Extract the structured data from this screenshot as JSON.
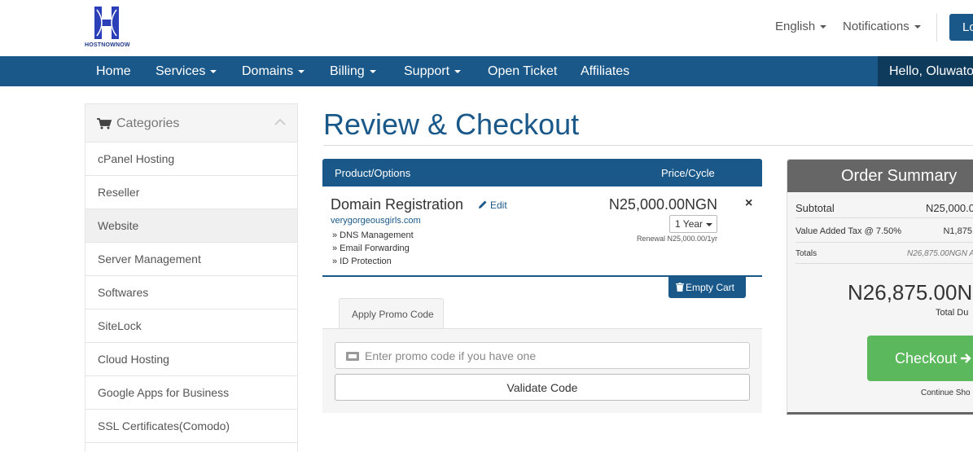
{
  "brand": {
    "logo_text": "HOSTNOWNOW"
  },
  "topbar": {
    "language": "English",
    "notifications": "Notifications",
    "login_label": "Lo"
  },
  "nav": {
    "items": [
      "Home",
      "Services",
      "Domains",
      "Billing",
      "Support",
      "Open Ticket",
      "Affiliates"
    ],
    "greeting": "Hello, Oluwato"
  },
  "sidebar": {
    "title": "Categories",
    "items": [
      "cPanel Hosting",
      "Reseller",
      "Website",
      "Server Management",
      "Softwares",
      "SiteLock",
      "Cloud Hosting",
      "Google Apps for Business",
      "SSL Certificates(Comodo)"
    ],
    "active_item": "Website"
  },
  "page": {
    "title": "Review & Checkout"
  },
  "cart": {
    "col_product": "Product/Options",
    "col_price": "Price/Cycle",
    "item": {
      "name": "Domain Registration",
      "edit_label": "Edit",
      "domain": "verygorgeousgirls.com",
      "addons": [
        "» DNS Management",
        "» Email Forwarding",
        "» ID Protection"
      ],
      "price": "N25,000.00NGN",
      "cycle": "1 Year",
      "renewal": "Renewal N25,000.00/1yr",
      "remove_label": "×"
    },
    "empty_cart_label": "Empty Cart"
  },
  "promo": {
    "tab_label": "Apply Promo Code",
    "placeholder": "Enter promo code if you have one",
    "validate_label": "Validate Code"
  },
  "summary": {
    "title": "Order Summary",
    "subtotal_label": "Subtotal",
    "subtotal_value": "N25,000.0",
    "vat_label": "Value Added Tax @ 7.50%",
    "vat_value": "N1,875.",
    "totals_label": "Totals",
    "totals_value": "N26,875.00NGN A",
    "total_amount": "N26,875.00N",
    "total_due_label": "Total Du",
    "checkout_label": "Checkout",
    "continue_label": "Continue Sho"
  },
  "colors": {
    "primary": "#1a5889",
    "primary_dark": "#0e3a5c",
    "success": "#5cb85c",
    "summary_head": "#666666"
  }
}
